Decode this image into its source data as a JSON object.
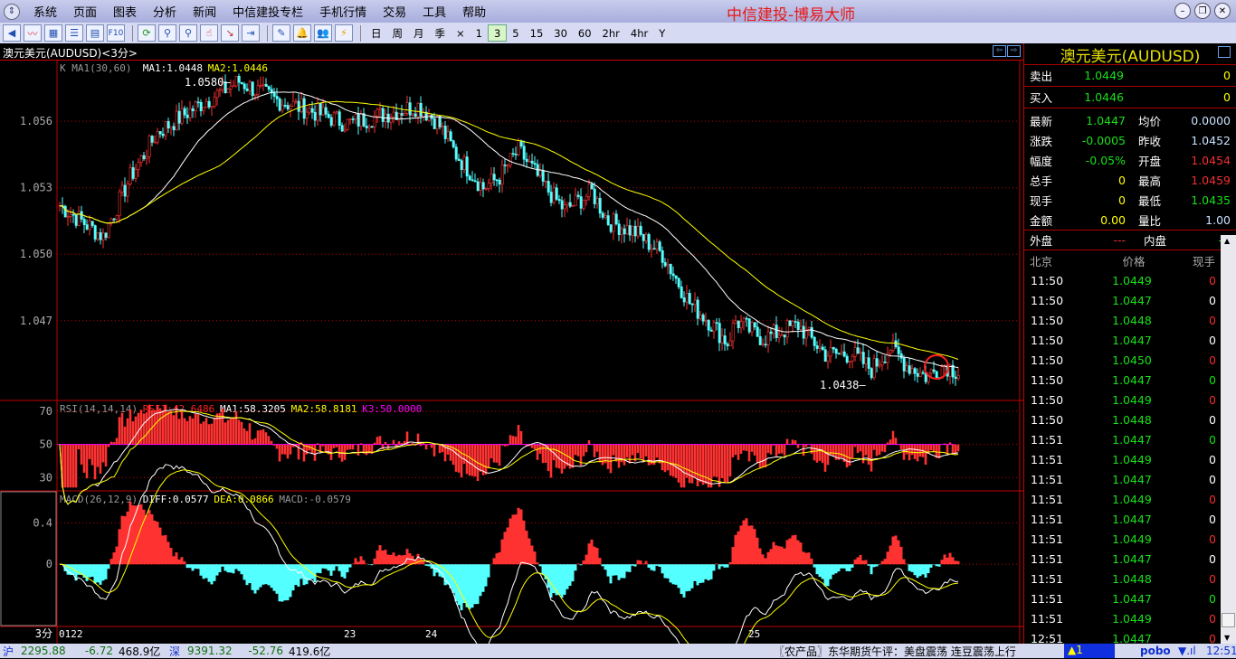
{
  "app": {
    "title": "中信建投-博易大师",
    "menu": [
      "系统",
      "页面",
      "图表",
      "分析",
      "新闻",
      "中信建投专栏",
      "手机行情",
      "交易",
      "工具",
      "帮助"
    ]
  },
  "toolbar": {
    "periods": [
      "日",
      "周",
      "月",
      "季",
      "×",
      "1",
      "3",
      "5",
      "15",
      "30",
      "60",
      "2hr",
      "4hr",
      "Y"
    ],
    "active_period": "3"
  },
  "chart": {
    "title": "澳元美元(AUDUSD)<3分>",
    "ma_legend": {
      "name": "K  MA1(30,60)",
      "ma1": "MA1:1.0448",
      "ma2": "MA2:1.0446"
    },
    "rsi_legend": {
      "name": "RSI(14,14,14)",
      "rsi1": "RSI1:42.6486",
      "ma1": "MA1:58.3205",
      "ma2": "MA2:58.8181",
      "k3": "K3:50.0000"
    },
    "macd_legend": {
      "name": "MACD(26,12,9)",
      "diff": "DIFF:0.0577",
      "dea": "DEA:0.0866",
      "macd": "MACD:-0.0579"
    },
    "period_label": "3分"
  },
  "chart_data": [
    {
      "type": "candlestick",
      "title": "澳元美元(AUDUSD) 3分",
      "y_ticks": [
        1.056,
        1.053,
        1.05,
        1.047
      ],
      "ylim": [
        1.0434,
        1.0587
      ],
      "high_label": "1.0580",
      "low_label": "1.0438",
      "x_labels": [
        "0122",
        "23",
        "24",
        "25"
      ],
      "x_label_bars": [
        0,
        105,
        135,
        254
      ],
      "close_path": [
        [
          0,
          1.0522
        ],
        [
          16,
          1.0508
        ],
        [
          26,
          1.0535
        ],
        [
          36,
          1.0555
        ],
        [
          52,
          1.0568
        ],
        [
          66,
          1.0578
        ],
        [
          79,
          1.057
        ],
        [
          92,
          1.0565
        ],
        [
          106,
          1.0559
        ],
        [
          119,
          1.0563
        ],
        [
          132,
          1.0567
        ],
        [
          139,
          1.056
        ],
        [
          146,
          1.0545
        ],
        [
          156,
          1.053
        ],
        [
          162,
          1.0535
        ],
        [
          169,
          1.0547
        ],
        [
          179,
          1.053
        ],
        [
          186,
          1.052
        ],
        [
          196,
          1.0528
        ],
        [
          202,
          1.0515
        ],
        [
          212,
          1.051
        ],
        [
          222,
          1.05
        ],
        [
          232,
          1.0478
        ],
        [
          239,
          1.047
        ],
        [
          246,
          1.046
        ],
        [
          249,
          1.047
        ],
        [
          259,
          1.0462
        ],
        [
          272,
          1.0468
        ],
        [
          282,
          1.0455
        ],
        [
          292,
          1.0455
        ],
        [
          299,
          1.0448
        ],
        [
          306,
          1.0458
        ],
        [
          312,
          1.045
        ],
        [
          319,
          1.0445
        ],
        [
          326,
          1.045
        ],
        [
          331,
          1.0447
        ]
      ]
    },
    {
      "type": "line",
      "title": "RSI",
      "y_ticks": [
        70,
        50,
        30
      ],
      "ylim": [
        22,
        76
      ]
    },
    {
      "type": "bar+line",
      "title": "MACD",
      "y_ticks": [
        0.4,
        0
      ],
      "ylim": [
        -0.6,
        0.7
      ]
    }
  ],
  "quote": {
    "title": "澳元美元(AUDUSD)",
    "sell": {
      "label": "卖出",
      "price": "1.0449",
      "vol": "0"
    },
    "buy": {
      "label": "买入",
      "price": "1.0446",
      "vol": "0"
    },
    "rows": [
      [
        "最新",
        "1.0447",
        "g",
        "均价",
        "0.0000",
        "b"
      ],
      [
        "涨跌",
        "-0.0005",
        "g",
        "昨收",
        "1.0452",
        "b"
      ],
      [
        "幅度",
        "-0.05%",
        "g",
        "开盘",
        "1.0454",
        "r"
      ],
      [
        "总手",
        "0",
        "y",
        "最高",
        "1.0459",
        "r"
      ],
      [
        "现手",
        "0",
        "y",
        "最低",
        "1.0435",
        "g"
      ],
      [
        "金额",
        "0.00",
        "y",
        "量比",
        "1.00",
        "b"
      ]
    ],
    "outer": {
      "label": "外盘",
      "value": "---"
    },
    "inner": {
      "label": "内盘",
      "value": "---"
    },
    "tick_headers": [
      "北京",
      "价格",
      "现手"
    ],
    "ticks": [
      [
        "11:50",
        "1.0449",
        "0",
        "r"
      ],
      [
        "11:50",
        "1.0447",
        "0",
        "w"
      ],
      [
        "11:50",
        "1.0448",
        "0",
        "r"
      ],
      [
        "11:50",
        "1.0447",
        "0",
        "w"
      ],
      [
        "11:50",
        "1.0450",
        "0",
        "r"
      ],
      [
        "11:50",
        "1.0447",
        "0",
        "g"
      ],
      [
        "11:50",
        "1.0449",
        "0",
        "r"
      ],
      [
        "11:50",
        "1.0448",
        "0",
        "w"
      ],
      [
        "11:51",
        "1.0447",
        "0",
        "g"
      ],
      [
        "11:51",
        "1.0449",
        "0",
        "w"
      ],
      [
        "11:51",
        "1.0447",
        "0",
        "w"
      ],
      [
        "11:51",
        "1.0449",
        "0",
        "r"
      ],
      [
        "11:51",
        "1.0447",
        "0",
        "w"
      ],
      [
        "11:51",
        "1.0449",
        "0",
        "r"
      ],
      [
        "11:51",
        "1.0447",
        "0",
        "w"
      ],
      [
        "11:51",
        "1.0448",
        "0",
        "r"
      ],
      [
        "11:51",
        "1.0447",
        "0",
        "g"
      ],
      [
        "11:51",
        "1.0449",
        "0",
        "r"
      ],
      [
        "12:51",
        "1.0447",
        "0",
        "r"
      ]
    ]
  },
  "status": {
    "sh_label": "沪",
    "sh_index": "2295.88",
    "sh_change": "-6.72",
    "sh_amount": "468.9亿",
    "sz_label": "深",
    "sz_index": "9391.32",
    "sz_change": "-52.76",
    "sz_amount": "419.6亿",
    "news": "〖农产品〗东华期货午评：美盘震荡 连豆震荡上行",
    "alert": "▲1",
    "brand": "pobo",
    "time": "12:51"
  },
  "colors": {
    "up": "#ff3232",
    "down": "#54ffff",
    "ma1": "#ffffff",
    "ma2": "#ffff00",
    "k3": "#ff00ff",
    "grid": "#c00000"
  }
}
